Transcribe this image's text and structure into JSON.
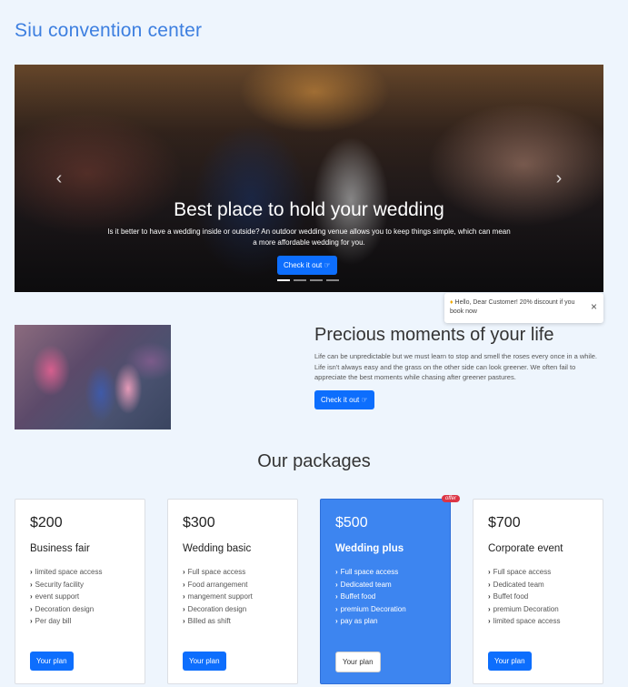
{
  "brand": "Siu convention center",
  "carousel": {
    "title": "Best place to hold your wedding",
    "text": "Is it better to have a wedding inside or outside? An outdoor wedding venue allows you to keep things simple, which can mean a more affordable wedding for you.",
    "button": "Check it out",
    "prev_icon": "chevron-left",
    "next_icon": "chevron-right",
    "slides": 4,
    "active_slide": 1
  },
  "toast": {
    "icon": "bell-icon",
    "message": "Hello, Dear Customer! 20% discount if you book now",
    "close": "×"
  },
  "moments": {
    "title": "Precious moments of your life",
    "text": "Life can be unpredictable but we must learn to stop and smell the roses every once in a while. Life isn't always easy and the grass on the other side can look greener. We often fail to appreciate the best moments while chasing after greener pastures.",
    "button": "Check it out"
  },
  "packages": {
    "heading": "Our packages",
    "button_label": "Your plan",
    "offer_badge": "offer",
    "items": [
      {
        "price": "$200",
        "name": "Business fair",
        "features": [
          "limited space access",
          "Security facility",
          "event support",
          "Decoration design",
          "Per day bill"
        ]
      },
      {
        "price": "$300",
        "name": "Wedding basic",
        "features": [
          "Full space access",
          "Food arrangement",
          "mangement support",
          "Decoration design",
          "Billed as shift"
        ]
      },
      {
        "price": "$500",
        "name": "Wedding plus",
        "features": [
          "Full space access",
          "Dedicated team",
          "Buffet food",
          "premium Decoration",
          "pay as plan"
        ]
      },
      {
        "price": "$700",
        "name": "Corporate event",
        "features": [
          "Full space access",
          "Dedicated team",
          "Buffet food",
          "premium Decoration",
          "limited space access"
        ]
      }
    ]
  },
  "colors": {
    "accent": "#0d6efd",
    "brand": "#3d7fe0",
    "featured_card": "#3d85f0",
    "background": "#eef5fd"
  }
}
